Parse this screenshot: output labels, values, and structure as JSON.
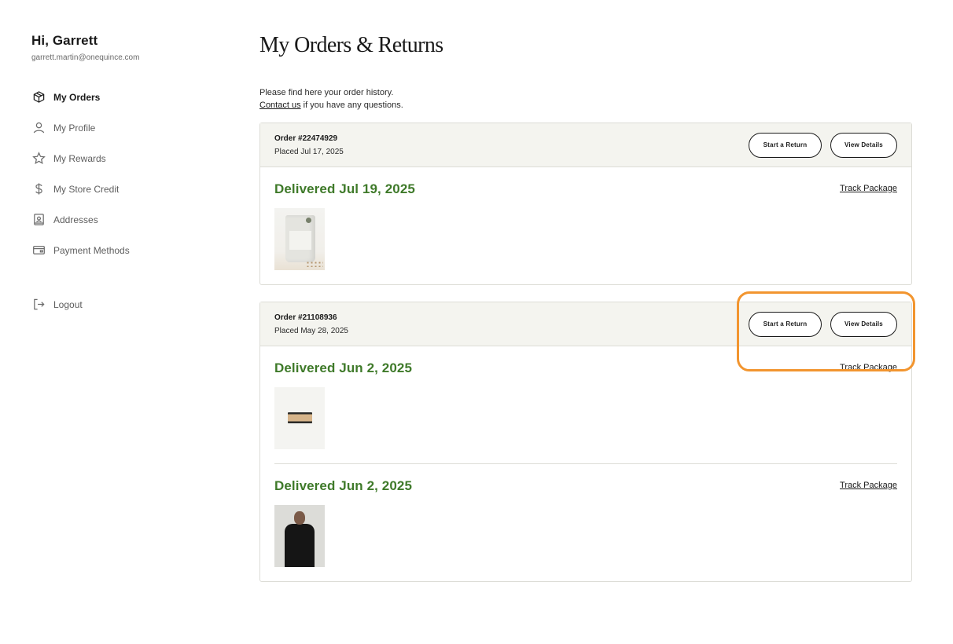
{
  "sidebar": {
    "greeting": "Hi, Garrett",
    "email": "garrett.martin@onequince.com",
    "nav": [
      {
        "label": "My Orders",
        "icon": "box-icon",
        "active": true
      },
      {
        "label": "My Profile",
        "icon": "user-icon"
      },
      {
        "label": "My Rewards",
        "icon": "star-icon"
      },
      {
        "label": "My Store Credit",
        "icon": "dollar-icon"
      },
      {
        "label": "Addresses",
        "icon": "address-book-icon"
      },
      {
        "label": "Payment Methods",
        "icon": "credit-card-icon"
      }
    ],
    "logout": {
      "label": "Logout",
      "icon": "logout-icon"
    }
  },
  "main": {
    "title": "My Orders & Returns",
    "intro_line1": "Please find here your order history.",
    "contact_link": "Contact us",
    "intro_line2_rest": " if you have any questions.",
    "start_return_label": "Start a Return",
    "view_details_label": "View Details",
    "track_label": "Track Package",
    "orders": [
      {
        "number": "Order #22474929",
        "placed": "Placed Jul 17, 2025",
        "shipments": [
          {
            "status": "Delivered Jul 19, 2025",
            "product": "coffee-bag"
          }
        ]
      },
      {
        "number": "Order #21108936",
        "placed": "Placed May 28, 2025",
        "shipments": [
          {
            "status": "Delivered Jun 2, 2025",
            "product": "wood-block"
          },
          {
            "status": "Delivered Jun 2, 2025",
            "product": "black-sweater"
          }
        ]
      }
    ]
  },
  "colors": {
    "delivered_green": "#3f7a2a",
    "header_bg": "#f4f4ef",
    "highlight_orange": "#f2952f"
  }
}
